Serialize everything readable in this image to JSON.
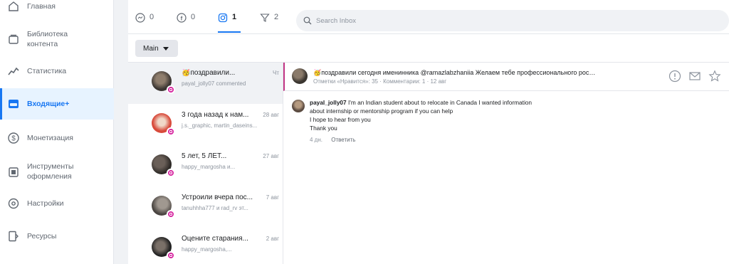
{
  "sidebar": {
    "items": [
      {
        "label": "Главная",
        "icon": "home-icon"
      },
      {
        "label": "Библиотека контента",
        "icon": "content-library-icon"
      },
      {
        "label": "Статистика",
        "icon": "stats-icon"
      },
      {
        "label": "Входящие+",
        "icon": "inbox-icon",
        "active": true
      },
      {
        "label": "Монетизация",
        "icon": "dollar-icon"
      },
      {
        "label": "Инструменты оформления",
        "icon": "creative-tools-icon"
      },
      {
        "label": "Настройки",
        "icon": "settings-icon"
      },
      {
        "label": "Ресурсы",
        "icon": "resources-icon"
      }
    ]
  },
  "tabs": [
    {
      "count": "0",
      "icon": "messenger-icon"
    },
    {
      "count": "0",
      "icon": "facebook-icon"
    },
    {
      "count": "1",
      "icon": "instagram-icon",
      "active": true
    },
    {
      "count": "2",
      "icon": "filter-icon"
    }
  ],
  "search": {
    "placeholder": "Search Inbox"
  },
  "filter": {
    "label": "Main"
  },
  "conversations": [
    {
      "title": "🥳поздравили...",
      "subtitle": "payal_jolly07 commented",
      "date": "Чт",
      "active": true
    },
    {
      "title": "3 года назад к нам...",
      "subtitle": "j.s._graphic, martin_daseins...",
      "date": "28 авг"
    },
    {
      "title": "5 лет, 5 ЛЕТ...",
      "subtitle": "happy_margosha и...",
      "date": "27 авг"
    },
    {
      "title": "Устроили вчера пос...",
      "subtitle": "tanuhhha777 и rad_rv эт...",
      "date": "7 авг"
    },
    {
      "title": "Оцените старания...",
      "subtitle": "happy_margosha,...",
      "date": "2 авг"
    }
  ],
  "post": {
    "title": "🥳поздравили сегодня именинника @ramazlabzhaniia Желаем тебе профессионального роста...",
    "meta": "Отметки «Нравится»: 35 · Комментарии: 1 · 12 авг"
  },
  "comment": {
    "author": "payal_jolly07",
    "lines": [
      "I'm an Indian student about to relocate in Canada I wanted information",
      "about internship or mentorship program if you can help",
      "I hope to hear from you",
      "Thank you"
    ],
    "time": "4 дн.",
    "reply_label": "Ответить"
  },
  "colors": {
    "accent": "#1877f2",
    "instagram": "#d6249f"
  }
}
